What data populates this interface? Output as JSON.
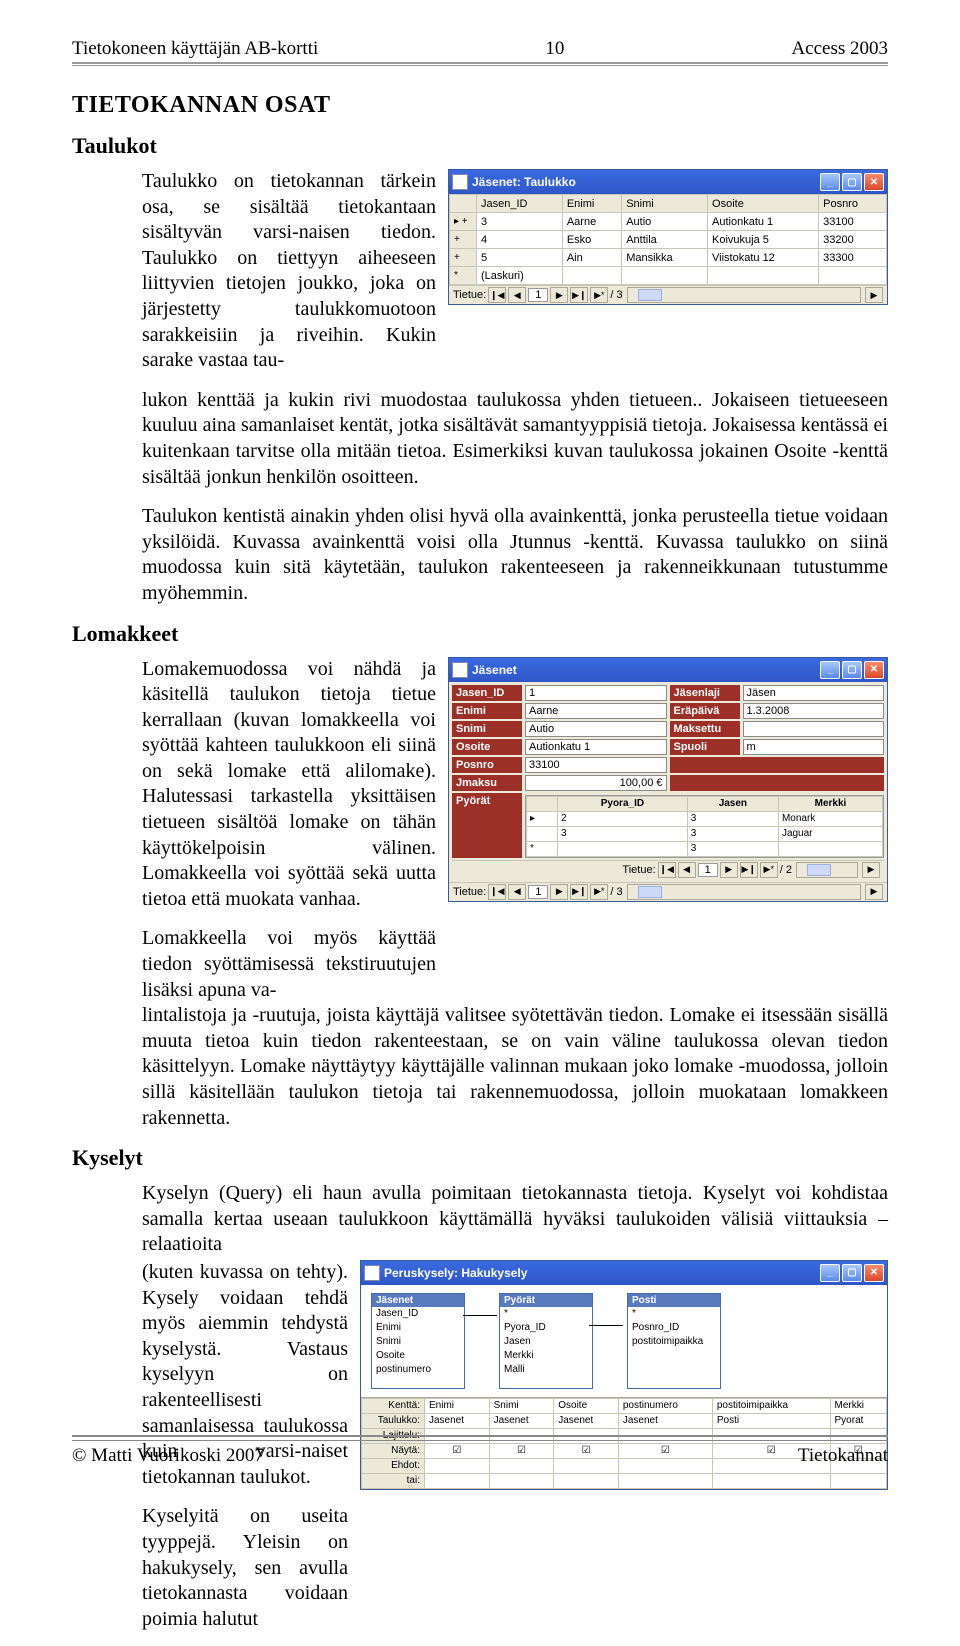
{
  "header": {
    "left": "Tietokoneen käyttäjän AB-kortti",
    "center": "10",
    "right": "Access 2003"
  },
  "h1": "TIETOKANNAN OSAT",
  "sec_taulukot": {
    "heading": "Taulukot",
    "p1": "Taulukko on tietokannan tärkein osa, se sisältää tietokantaan sisältyvän varsi-naisen tiedon. Taulukko on tiettyyn aiheeseen liittyvien tietojen joukko, joka on järjestetty taulukkomuotoon sarakkeisiin ja riveihin. Kukin sarake vastaa taulukon kenttää ja kukin rivi muodostaa taulukossa yhden tietueen.. Jokaiseen tietueeseen kuuluu aina samanlaiset kentät, jotka sisältävät samantyyppisiä tietoja. Jokaisessa kentässä ei kuitenkaan tarvitse olla mitään tietoa. Esimerkiksi kuvan taulukossa jokainen Osoite -kenttä sisältää jonkun henkilön osoitteen.",
    "p1_short": "Taulukko on tietokannan tärkein osa, se sisältää tietokantaan sisältyvän varsi-naisen tiedon. Taulukko on tiettyyn aiheeseen liittyvien tietojen joukko, joka on järjestetty taulukkomuotoon sarakkeisiin ja riveihin. Kukin sarake vastaa tau-",
    "p1_rest": "lukon kenttää ja kukin rivi muodostaa taulukossa yhden tietueen.. Jokaiseen tietueeseen kuuluu aina samanlaiset kentät, jotka sisältävät samantyyppisiä tietoja. Jokaisessa kentässä ei kuitenkaan tarvitse olla mitään tietoa. Esimerkiksi kuvan taulukossa jokainen Osoite -kenttä sisältää jonkun henkilön osoitteen.",
    "p2": "Taulukon kentistä ainakin yhden olisi hyvä olla avainkenttä, jonka perusteella tietue voidaan yksilöidä. Kuvassa avainkenttä voisi olla Jtunnus -kenttä. Kuvassa taulukko on siinä muodossa kuin sitä käytetään, taulukon rakenteeseen ja rakenneikkunaan tutustumme myöhemmin."
  },
  "sec_lomakkeet": {
    "heading": "Lomakkeet",
    "p1": "Lomakemuodossa voi nähdä ja käsitellä taulukon tietoja tietue kerrallaan (kuvan lomakkeella voi syöttää kahteen taulukkoon eli siinä on sekä lomake että alilomake). Halutessasi tarkastella yksittäisen tietueen sisältöä lomake on tähän käyttökelpoisin välinen. Lomakkeella voi syöttää sekä uutta tietoa että muokata vanhaa.",
    "p2_a": "Lomakkeella voi myös käyttää tiedon syöttämisessä tekstiruutujen lisäksi apuna va-",
    "p2_b": "lintalistoja ja -ruutuja, joista käyttäjä valitsee syötettävän tiedon. Lomake ei itsessään sisällä muuta tietoa kuin tiedon rakenteestaan, se on vain väline taulukossa olevan tiedon käsittelyyn. Lomake näyttäytyy käyttäjälle valinnan mukaan joko lomake -muodossa, jolloin sillä käsitellään taulukon tietoja tai rakennemuodossa, jolloin muokataan lomakkeen rakennetta."
  },
  "sec_kyselyt": {
    "heading": "Kyselyt",
    "p1_a": "Kyselyn (Query) eli haun avulla poimitaan tietokannasta tietoja. Kyselyt voi kohdistaa samalla kertaa useaan taulukkoon käyttämällä hyväksi taulukoiden välisiä viittauksia – relaatioita",
    "p1_b": "(kuten kuvassa on tehty). Kysely voidaan tehdä myös aiemmin tehdystä kyselystä. Vastaus kyselyyn on rakenteellisesti samanlaisessa taulukossa kuin varsi-naiset tietokannan taulukot.",
    "p2": "Kyselyitä on useita tyyppejä. Yleisin on hakukysely, sen avulla tietokannasta voidaan poimia halutut"
  },
  "screenshot_table": {
    "title": "Jäsenet: Taulukko",
    "headers": [
      "Jasen_ID",
      "Enimi",
      "Snimi",
      "Osoite",
      "Posnro"
    ],
    "rows": [
      [
        "3",
        "Aarne",
        "Autio",
        "Autionkatu 1",
        "33100"
      ],
      [
        "4",
        "Esko",
        "Anttila",
        "Koivukuja 5",
        "33200"
      ],
      [
        "5",
        "Ain",
        "Mansikka",
        "Viistokatu 12",
        "33300"
      ]
    ],
    "laskuri_label": "(Laskuri)",
    "nav_label": "Tietue:",
    "nav_value": "1",
    "nav_total": "/ 3"
  },
  "screenshot_form": {
    "title": "Jäsenet",
    "fields": {
      "Jasen_ID": "1",
      "Jäsenlaji": "Jäsen",
      "Enimi": "Aarne",
      "Eräpäivä": "1.3.2008",
      "Snimi": "Autio",
      "Maksettu": "",
      "Osoite": "Autionkatu 1",
      "Spuoli": "m",
      "Posnro": "33100",
      "Jmaksu": "100,00 €",
      "Pyörät": ""
    },
    "sub": {
      "headers": [
        "Pyora_ID",
        "Jasen",
        "Merkki"
      ],
      "rows": [
        [
          "2",
          "3",
          "Monark"
        ],
        [
          "3",
          "3",
          "Jaguar"
        ],
        [
          "",
          "3",
          ""
        ]
      ]
    },
    "nav1_label": "Tietue:",
    "nav1_value": "1",
    "nav1_total": "/ 2",
    "nav2_label": "Tietue:",
    "nav2_value": "1",
    "nav2_total": "/ 3"
  },
  "screenshot_query": {
    "title": "Peruskysely: Hakukysely",
    "tables": {
      "Jasenet": [
        "Jasen_ID",
        "Enimi",
        "Snimi",
        "Osoite",
        "postinumero"
      ],
      "Pyorat": [
        "*",
        "Pyora_ID",
        "Jasen",
        "Merkki",
        "Malli"
      ],
      "Posti": [
        "*",
        "Posnro_ID",
        "postitoimipaikka"
      ]
    },
    "grid_labels": [
      "Kenttä:",
      "Taulukko:",
      "Lajittelu:",
      "Näytä:",
      "Ehdot:",
      "tai:"
    ],
    "grid": {
      "Kenttä": [
        "Enimi",
        "Snimi",
        "Osoite",
        "postinumero",
        "postitoimipaikka",
        "Merkki"
      ],
      "Taulukko": [
        "Jasenet",
        "Jasenet",
        "Jasenet",
        "Jasenet",
        "Posti",
        "Pyorat"
      ]
    }
  },
  "footer": {
    "left": "© Matti Vuorikoski 2007",
    "right": "Tietokannat"
  }
}
